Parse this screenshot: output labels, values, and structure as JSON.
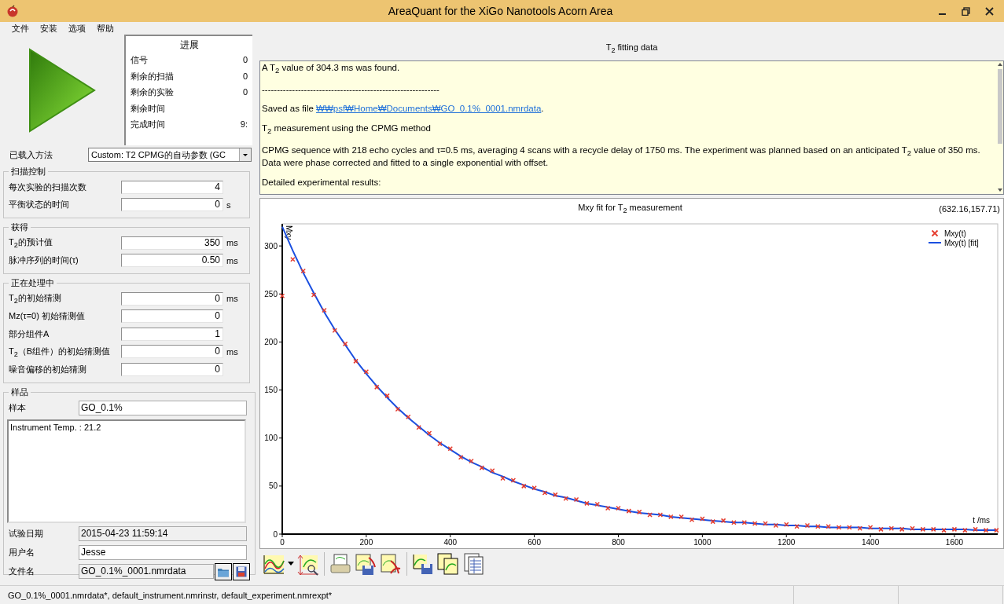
{
  "window": {
    "title": "AreaQuant for the XiGo Nanotools Acorn Area"
  },
  "menu": [
    "文件",
    "安装",
    "选项",
    "帮助"
  ],
  "progress": {
    "title": "进展",
    "rows": [
      {
        "label": "信号",
        "value": "0"
      },
      {
        "label": "剩余的扫描",
        "value": "0"
      },
      {
        "label": "剩余的实验",
        "value": "0"
      },
      {
        "label": "剩余时间"
      },
      {
        "label": "完成时间",
        "value": "9:"
      }
    ]
  },
  "method": {
    "label": "已载入方法",
    "value": "Custom: T2 CPMG的自动参数 (GC"
  },
  "groups": [
    {
      "title": "扫描控制",
      "fields": [
        {
          "label": "每次实验的扫描次数",
          "value": "4"
        },
        {
          "label": "平衡状态的时间",
          "value": "0",
          "unit": "s"
        }
      ]
    },
    {
      "title": "获得",
      "fields": [
        {
          "label": "T$_{2}$的预计值",
          "value": "350",
          "unit": "ms"
        },
        {
          "label": "脉冲序列的时间(τ)",
          "value": "0.50",
          "unit": "ms"
        }
      ]
    },
    {
      "title": "正在处理中",
      "fields": [
        {
          "label": "T$_{2}$的初始猜测",
          "value": "0",
          "unit": "ms"
        },
        {
          "label": "Mz(τ=0) 初始猜测值",
          "value": "0"
        },
        {
          "label": "部分组件A",
          "value": "1"
        },
        {
          "label": "T$_{2}$（B组件）的初始猜测值",
          "value": "0",
          "unit": "ms"
        },
        {
          "label": "噪音偏移的初始猜测",
          "value": "0"
        }
      ]
    }
  ],
  "sample": {
    "title": "样品",
    "fields": [
      {
        "kind": "text",
        "label": "样本",
        "value": "GO_0.1%",
        "readonly": false
      },
      {
        "kind": "notes",
        "value": "Instrument Temp. : 21.2",
        "readonly": false
      },
      {
        "kind": "text",
        "label": "试验日期",
        "value": "2015-04-23 11:59:14",
        "readonly": true
      },
      {
        "kind": "text",
        "label": "用户名",
        "value": "Jesse",
        "readonly": false
      },
      {
        "kind": "file",
        "label": "文件名",
        "value": "GO_0.1%_0001.nmrdata",
        "readonly": true
      }
    ]
  },
  "fitting": {
    "title": "T$_{2}$ fitting data",
    "paragraphs": [
      {
        "kind": "text",
        "lines": [
          "A T$_{2}$  value of 304.3 ms was found."
        ]
      },
      {
        "kind": "text",
        "lines": [
          "-----------------------------------------------------------"
        ]
      },
      {
        "kind": "link",
        "text": "Saved as file ",
        "link": "₩₩psf₩Home₩Documents₩GO_0.1%_0001.nmrdata",
        "after": "."
      },
      {
        "kind": "text",
        "lines": [
          "T$_{2}$  measurement using the CPMG method"
        ]
      },
      {
        "kind": "text",
        "lines": [
          "CPMG sequence with 218 echo cycles and τ=0.5 ms, averaging 4 scans with a recycle delay of 1750 ms. The experiment was planned based on an anticipated T$_{2}$  value of 350 ms.",
          "Data were phase corrected and fitted to a single exponential with offset."
        ]
      },
      {
        "kind": "text",
        "lines": [
          "Detailed experimental results:"
        ]
      }
    ]
  },
  "chart": {
    "readout": "(632.16,157.71)",
    "chart_data": {
      "type": "scatter",
      "legend": "upper right",
      "title": "Mxy fit for T$_{2}$ measurement",
      "xlabel": "t /ms",
      "ylabel": "Mxy",
      "xlim": [
        0,
        1703
      ],
      "ylim": [
        0,
        323
      ],
      "xticks": [
        0,
        200,
        400,
        600,
        800,
        1000,
        1200,
        1400,
        1600
      ],
      "yticks": [
        0,
        50,
        100,
        150,
        200,
        250,
        300
      ],
      "x": [
        0,
        25,
        50,
        75,
        100,
        125,
        150,
        175,
        200,
        225,
        250,
        275,
        300,
        325,
        350,
        375,
        400,
        425,
        450,
        475,
        500,
        525,
        550,
        575,
        600,
        625,
        650,
        675,
        700,
        725,
        750,
        775,
        800,
        825,
        850,
        875,
        900,
        925,
        950,
        975,
        1000,
        1025,
        1050,
        1075,
        1100,
        1125,
        1150,
        1175,
        1200,
        1225,
        1250,
        1275,
        1300,
        1325,
        1350,
        1375,
        1400,
        1425,
        1450,
        1475,
        1500,
        1525,
        1550,
        1575,
        1600,
        1625,
        1650,
        1675,
        1700
      ],
      "series": [
        {
          "name": "Mxy(t) [fit]",
          "type": "line",
          "color": "#1a4fe0",
          "values": [
            320,
            295,
            272,
            251,
            231,
            213,
            197,
            181,
            167,
            154,
            142,
            131,
            121,
            112,
            103,
            95,
            88,
            81,
            75,
            70,
            64,
            60,
            55,
            51,
            47,
            44,
            40,
            38,
            35,
            32,
            30,
            28,
            26,
            24,
            22,
            21,
            20,
            18,
            17,
            16,
            15,
            14,
            13,
            12,
            12,
            11,
            10,
            10,
            9,
            9,
            8,
            8,
            7,
            7,
            7,
            7,
            6,
            6,
            6,
            6,
            5,
            5,
            5,
            5,
            5,
            5,
            4,
            4,
            4
          ]
        },
        {
          "name": "Mxy(t)",
          "marker": "x",
          "color": "#e53c2e",
          "values": [
            248,
            286,
            274,
            249,
            233,
            212,
            198,
            180,
            169,
            153,
            144,
            130,
            122,
            111,
            105,
            94,
            89,
            80,
            76,
            69,
            66,
            58,
            56,
            50,
            48,
            43,
            41,
            37,
            36,
            32,
            31,
            27,
            27,
            24,
            23,
            20,
            20,
            18,
            18,
            15,
            16,
            13,
            14,
            12,
            12,
            11,
            11,
            9,
            10,
            8,
            9,
            8,
            8,
            7,
            7,
            6,
            7,
            5,
            6,
            5,
            6,
            5,
            5,
            4,
            5,
            4,
            5,
            4,
            4
          ]
        }
      ]
    }
  },
  "status_bar": [
    "GO_0.1%_0001.nmrdata*, default_instrument.nmrinstr, default_experiment.nmrexpt*"
  ]
}
